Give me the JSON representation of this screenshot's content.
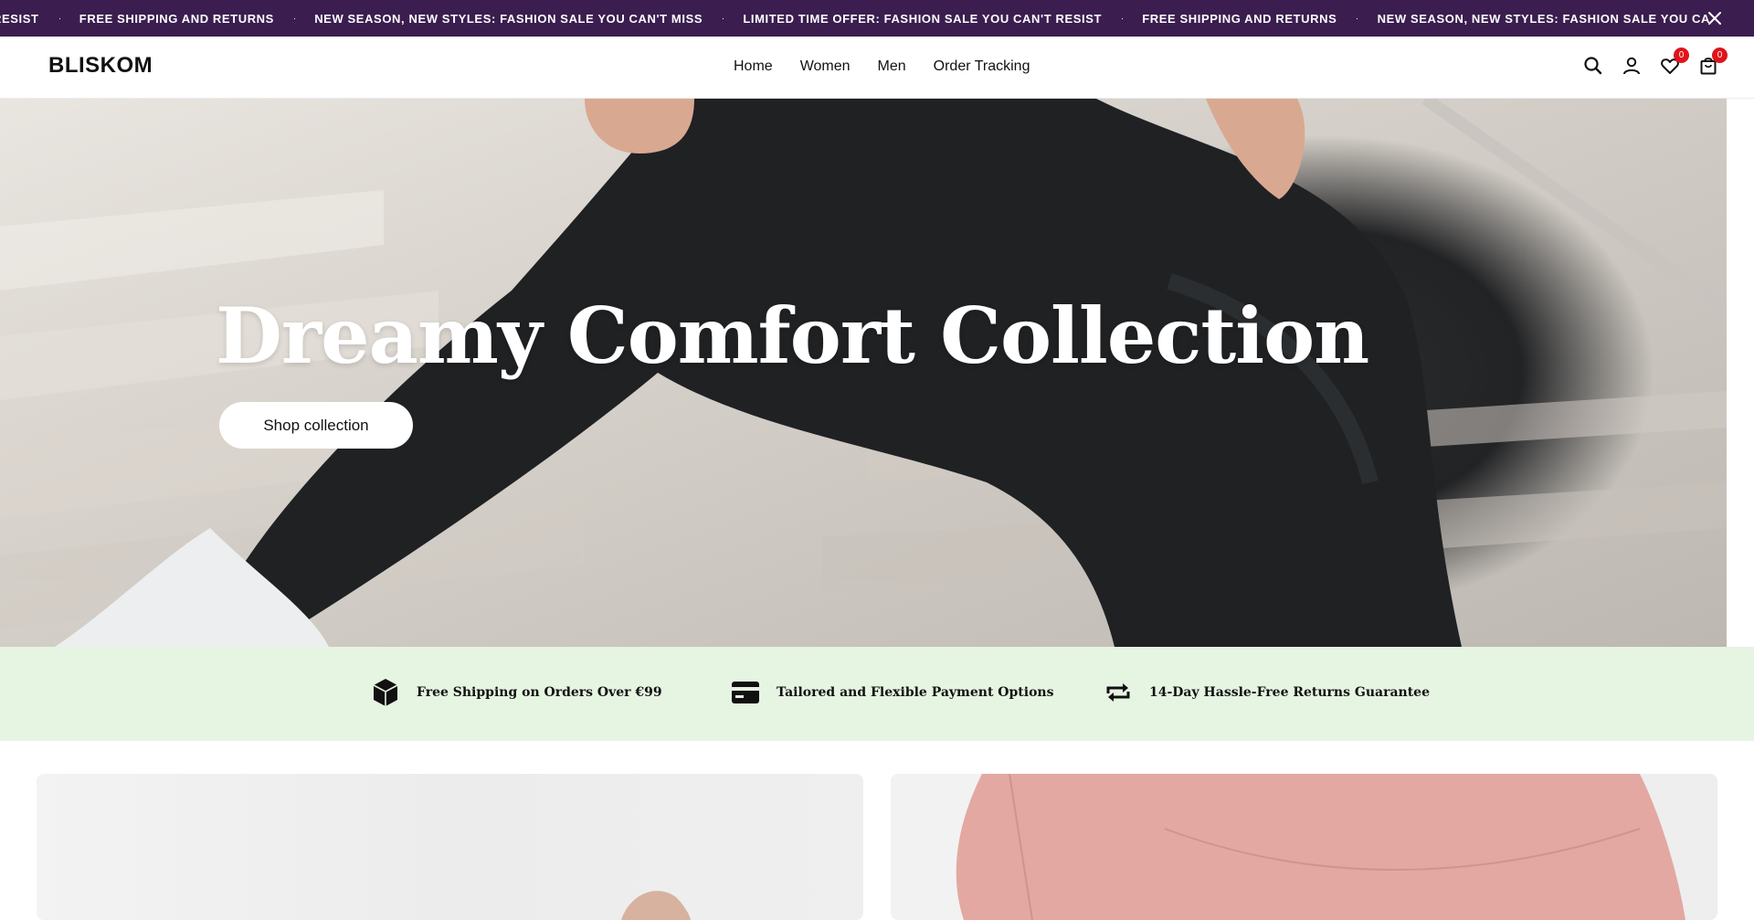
{
  "announcement": {
    "items": [
      "RESIST",
      "FREE SHIPPING AND RETURNS",
      "NEW SEASON, NEW STYLES: FASHION SALE YOU CAN'T MISS",
      "LIMITED TIME OFFER: FASHION SALE YOU CAN'T RESIST",
      "FREE SHIPPING AND RETURNS",
      "NEW SEASON, NEW STYLES: FASHION SALE YOU CA"
    ],
    "close_icon": "close-icon",
    "background": "#3b1e4f"
  },
  "header": {
    "logo": "BLISKOM",
    "nav": [
      "Home",
      "Women",
      "Men",
      "Order Tracking"
    ],
    "tools": {
      "search_icon": "search-icon",
      "account_icon": "user-icon",
      "wishlist_icon": "heart-icon",
      "wishlist_count": "0",
      "cart_icon": "bag-icon",
      "cart_count": "0"
    },
    "badge_color": "#e0141c"
  },
  "hero": {
    "title": "Dreamy Comfort Collection",
    "button": "Shop collection"
  },
  "features": {
    "background": "#e6f4e2",
    "items": [
      {
        "icon": "box-icon",
        "text": "Free Shipping on Orders Over €99"
      },
      {
        "icon": "credit-card-icon",
        "text": "Tailored and Flexible Payment Options"
      },
      {
        "icon": "repeat-icon",
        "text": "14-Day Hassle-Free Returns Guarantee"
      }
    ]
  }
}
